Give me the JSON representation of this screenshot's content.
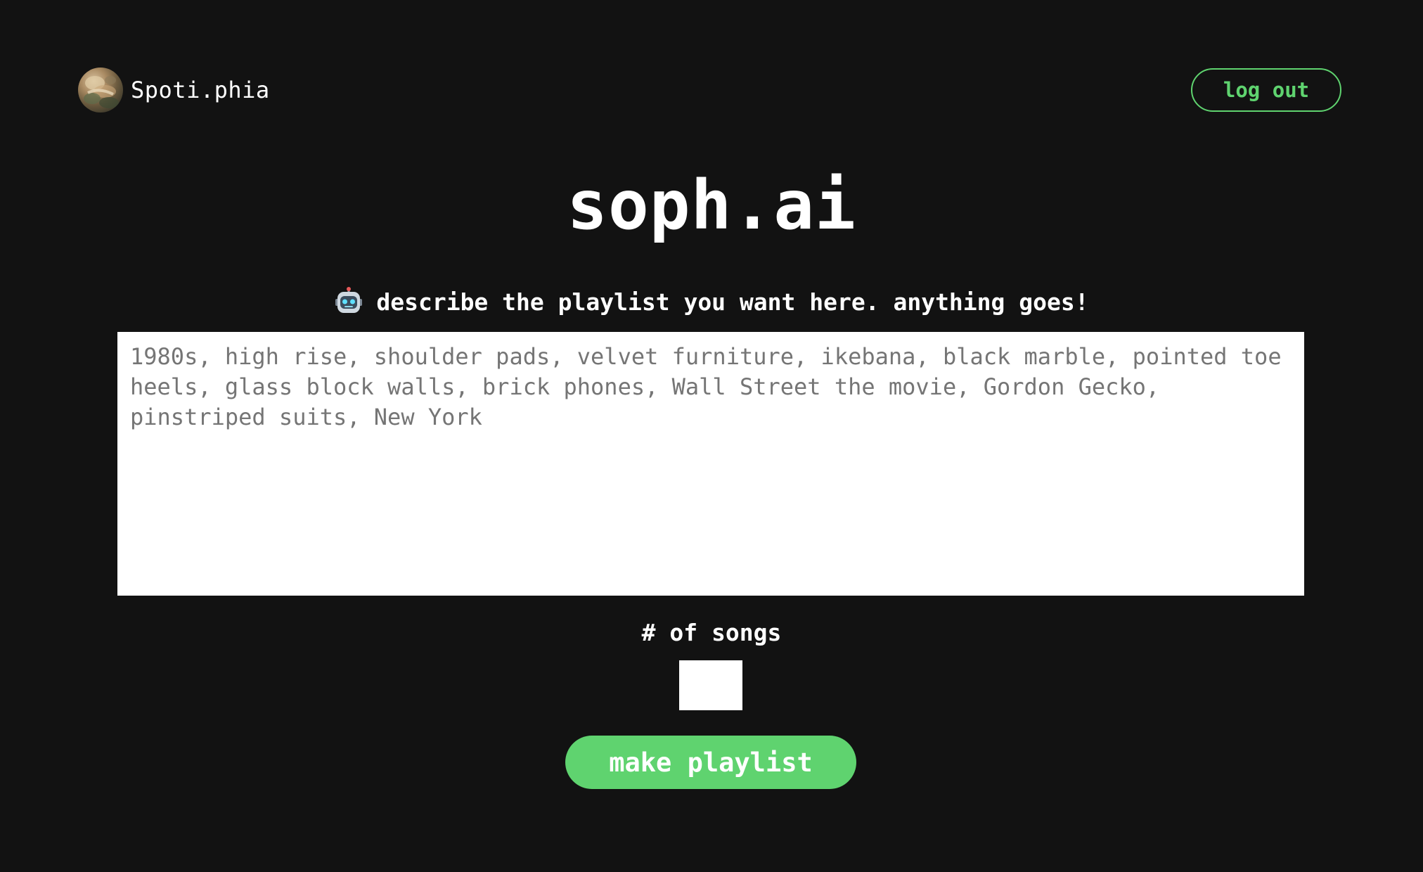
{
  "header": {
    "username": "Spoti.phia",
    "logout_label": "log out"
  },
  "main": {
    "title": "soph.ai",
    "prompt_label": "describe the playlist you want here. anything goes!",
    "prompt_icon": "robot-icon",
    "prompt_placeholder": "1980s, high rise, shoulder pads, velvet furniture, ikebana, black marble, pointed toe heels, glass block walls, brick phones, Wall Street the movie, Gordon Gecko, pinstriped suits, New York",
    "prompt_value": "",
    "songs_label": "# of songs",
    "songs_value": "",
    "make_button_label": "make playlist"
  },
  "colors": {
    "background": "#121212",
    "accent": "#5fd36f",
    "text": "#ffffff",
    "placeholder": "#757575"
  }
}
